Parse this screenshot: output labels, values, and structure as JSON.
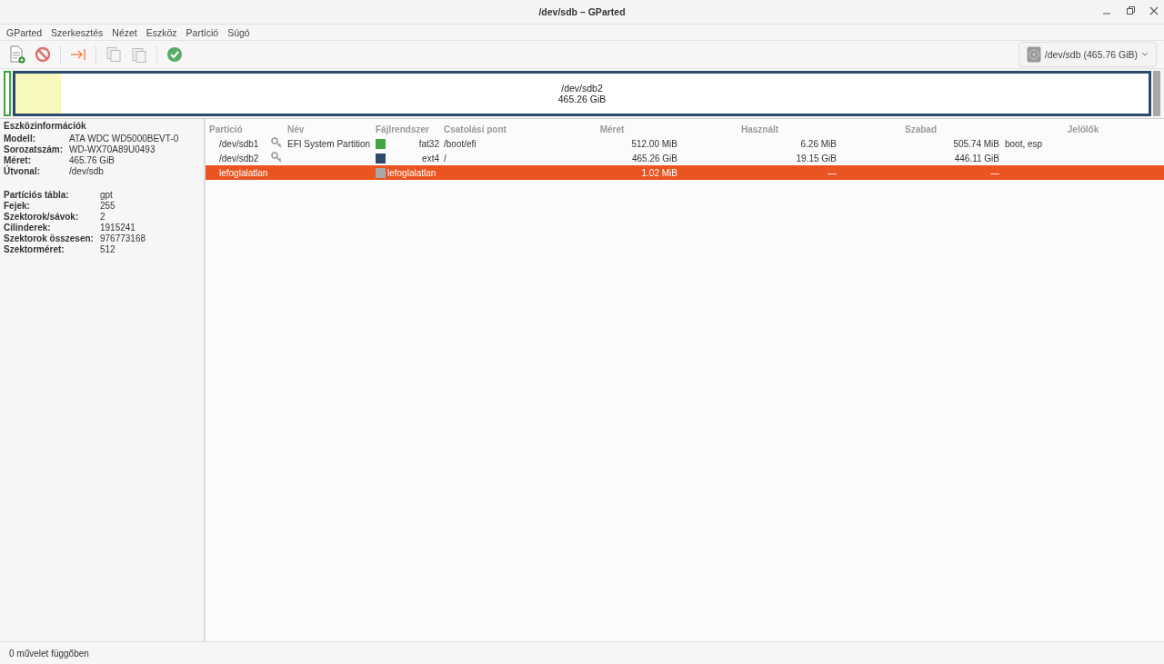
{
  "window": {
    "title": "/dev/sdb – GParted"
  },
  "menu": [
    "GParted",
    "Szerkesztés",
    "Nézet",
    "Eszköz",
    "Partíció",
    "Súgó"
  ],
  "device_selector": {
    "value": "/dev/sdb (465.76 GiB)"
  },
  "disk_map": [
    {
      "kind": "partition",
      "color": "#3fa63f"
    },
    {
      "kind": "partition",
      "color": "#2c4a6b",
      "level": 0.04,
      "name": "/dev/sdb2",
      "size": "465.26 GiB"
    },
    {
      "kind": "unallocated",
      "color": "#a8a8a8"
    }
  ],
  "device_info": {
    "title": "Eszközinformációk",
    "group_1": [
      {
        "label": "Modell:",
        "value": "ATA WDC WD5000BEVT-0"
      },
      {
        "label": "Sorozatszám:",
        "value": "WD-WX70A89U0493"
      },
      {
        "label": "Méret:",
        "value": "465.76 GiB"
      },
      {
        "label": "Útvonal:",
        "value": "/dev/sdb"
      }
    ],
    "group_2": [
      {
        "label": "Partíciós tábla:",
        "value": "gpt"
      },
      {
        "label": "Fejek:",
        "value": "255"
      },
      {
        "label": "Szektorok/sávok:",
        "value": "2"
      },
      {
        "label": "Cilinderek:",
        "value": "1915241"
      },
      {
        "label": "Szektorok összesen:",
        "value": "976773168"
      },
      {
        "label": "Szektorméret:",
        "value": "512"
      }
    ]
  },
  "table": {
    "columns": [
      "Partíció",
      "Név",
      "Fájlrendszer",
      "Csatolási pont",
      "Méret",
      "Használt",
      "Szabad",
      "Jelölők"
    ],
    "rows": [
      {
        "partition": "/dev/sdb1",
        "mounted": true,
        "name": "EFI System Partition",
        "color": "#3fa63f",
        "filesystem": "fat32",
        "mount_point": "/boot/efi",
        "size": "512.00 MiB",
        "used": "6.26 MiB",
        "free": "505.74 MiB",
        "flags": "boot, esp",
        "selected": false
      },
      {
        "partition": "/dev/sdb2",
        "mounted": true,
        "color": "#2c4a6b",
        "filesystem": "ext4",
        "mount_point": "/",
        "size": "465.26 GiB",
        "used": "19.15 GiB",
        "free": "446.11 GiB",
        "selected": false
      },
      {
        "partition": "lefoglalatlan",
        "mounted": false,
        "color": "#a8a8a8",
        "filesystem": "lefoglalatlan",
        "size": "1.02 MiB",
        "used": "—",
        "free": "—",
        "selected": true
      }
    ]
  },
  "status_bar": "0 művelet függőben"
}
